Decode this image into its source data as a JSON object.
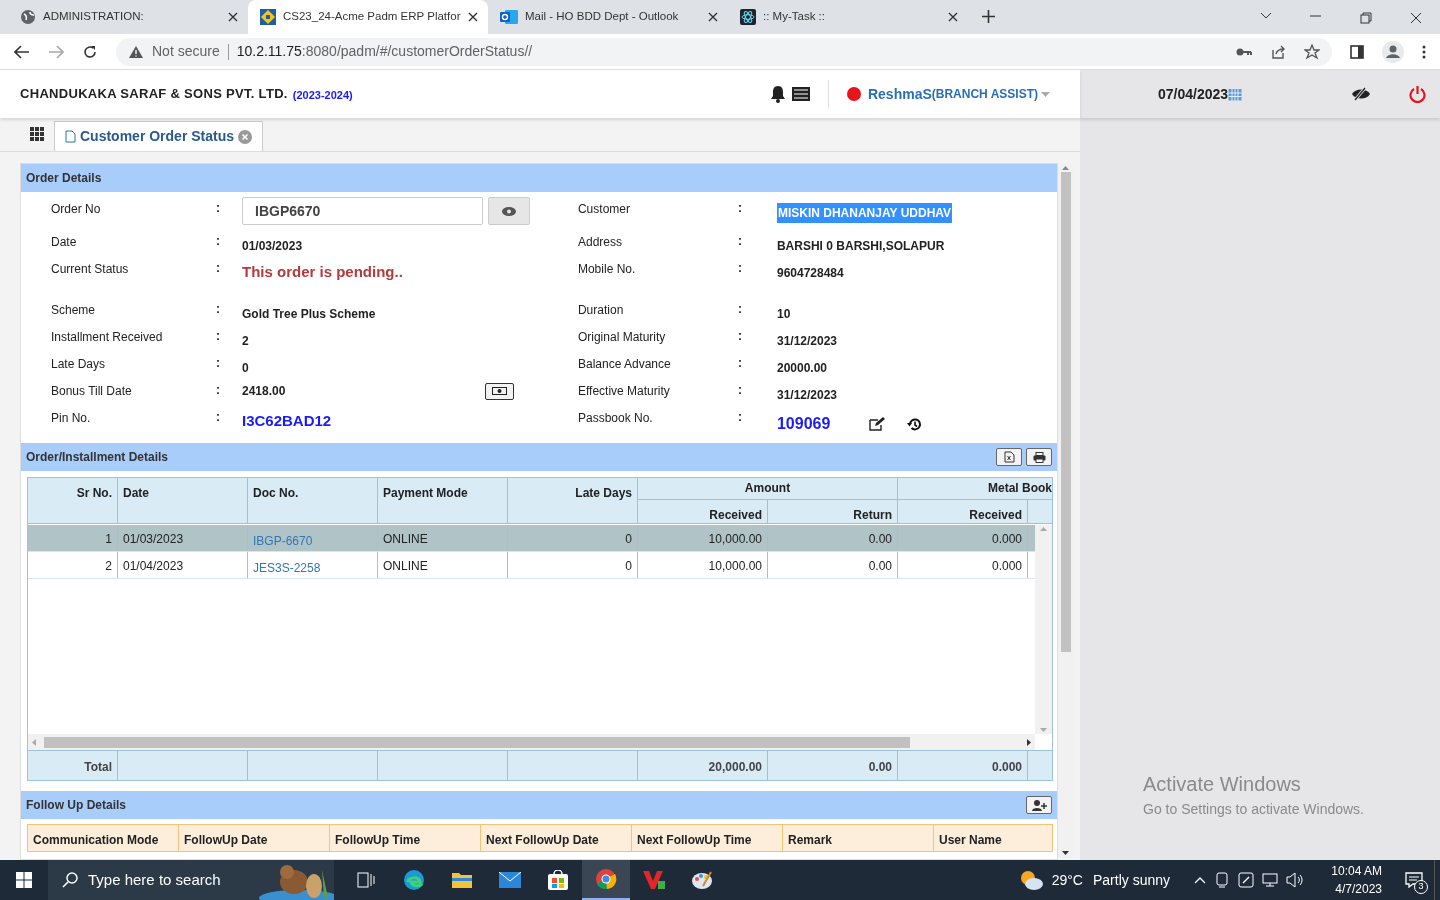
{
  "browser": {
    "tabs": [
      {
        "title": "ADMINISTRATION:",
        "selected": false
      },
      {
        "title": "CS23_24-Acme Padm ERP Platfor",
        "selected": true
      },
      {
        "title": "Mail - HO BDD Dept - Outlook",
        "selected": false
      },
      {
        "title": ":: My-Task ::",
        "selected": false
      }
    ],
    "security": "Not secure",
    "url_host": "10.2.11.75",
    "url_rest": ":8080/padm/#/customerOrderStatus//"
  },
  "header": {
    "company": "CHANDUKAKA SARAF & SONS PVT. LTD.",
    "year": "(2023-2024)",
    "user": "ReshmaS",
    "role": "(BRANCH ASSIST)",
    "online": true,
    "date": "07/04/2023"
  },
  "page_tabs": [
    {
      "label": "Customer Order Status",
      "selected": true
    }
  ],
  "order_details": {
    "title": "Order Details",
    "rows": [
      {
        "left": {
          "label": "Order No",
          "sep": ":",
          "value": "IBGP6670",
          "kind": "input"
        },
        "right": {
          "label": "Customer",
          "sep": ":",
          "value": "MISKIN DHANANJAY UDDHAV",
          "kind": "highlight"
        }
      },
      {
        "left": {
          "label": "Date",
          "sep": ":",
          "value": "01/03/2023",
          "kind": "plain"
        },
        "right": {
          "label": "Address",
          "sep": ":",
          "value": "BARSHI 0 BARSHI,SOLAPUR",
          "kind": "plain"
        }
      },
      {
        "left": {
          "label": "Current Status",
          "sep": ":",
          "value": "This order is pending..",
          "kind": "status"
        },
        "right": {
          "label": "Mobile No.",
          "sep": ":",
          "value": "9604728484",
          "kind": "plain"
        }
      },
      {
        "left": {
          "label": "Scheme",
          "sep": ":",
          "value": "Gold Tree Plus Scheme",
          "kind": "plain"
        },
        "right": {
          "label": "Duration",
          "sep": ":",
          "value": "10",
          "kind": "plain"
        }
      },
      {
        "left": {
          "label": "Installment Received",
          "sep": ":",
          "value": "2",
          "kind": "plain"
        },
        "right": {
          "label": "Original Maturity",
          "sep": ":",
          "value": "31/12/2023",
          "kind": "plain"
        }
      },
      {
        "left": {
          "label": "Late Days",
          "sep": ":",
          "value": "0",
          "kind": "plain"
        },
        "right": {
          "label": "Balance Advance",
          "sep": ":",
          "value": "20000.00",
          "kind": "plain"
        }
      },
      {
        "left": {
          "label": "Bonus Till Date",
          "sep": ":",
          "value": "2418.00",
          "kind": "money"
        },
        "right": {
          "label": "Effective Maturity",
          "sep": ":",
          "value": "31/12/2023",
          "kind": "plain"
        }
      },
      {
        "left": {
          "label": "Pin No.",
          "sep": ":",
          "value": "I3C62BAD12",
          "kind": "code"
        },
        "right": {
          "label": "Passbook No.",
          "sep": ":",
          "value": "109069",
          "kind": "passbook"
        }
      }
    ]
  },
  "installments": {
    "title": "Order/Installment Details",
    "columns": [
      "Sr No.",
      "Date",
      "Doc No.",
      "Payment Mode",
      "Late Days"
    ],
    "groups": [
      {
        "label": "Amount",
        "columns": [
          "Received",
          "Return"
        ]
      },
      {
        "label": "Metal Book",
        "columns": [
          "Received"
        ]
      }
    ],
    "rows": [
      {
        "selected": true,
        "cells": [
          "1",
          "01/03/2023",
          "IBGP-6670",
          "ONLINE",
          "0",
          "10,000.00",
          "0.00",
          "0.000"
        ]
      },
      {
        "selected": false,
        "cells": [
          "2",
          "01/04/2023",
          "JES3S-2258",
          "ONLINE",
          "0",
          "10,000.00",
          "0.00",
          "0.000"
        ]
      }
    ],
    "total": {
      "label": "Total",
      "cells": [
        "20,000.00",
        "0.00",
        "0.000"
      ]
    }
  },
  "follow_up": {
    "title": "Follow Up Details",
    "columns": [
      "Communication Mode",
      "FollowUp Date",
      "FollowUp Time",
      "Next FollowUp Date",
      "Next FollowUp Time",
      "Remark",
      "User Name"
    ]
  },
  "activation": {
    "title": "Activate Windows",
    "text": "Go to Settings to activate Windows."
  },
  "taskbar": {
    "search": "Type here to search",
    "temperature": "29°C",
    "weather": "Partly sunny",
    "time": "10:04 AM",
    "date": "4/7/2023",
    "notifications": "3"
  }
}
